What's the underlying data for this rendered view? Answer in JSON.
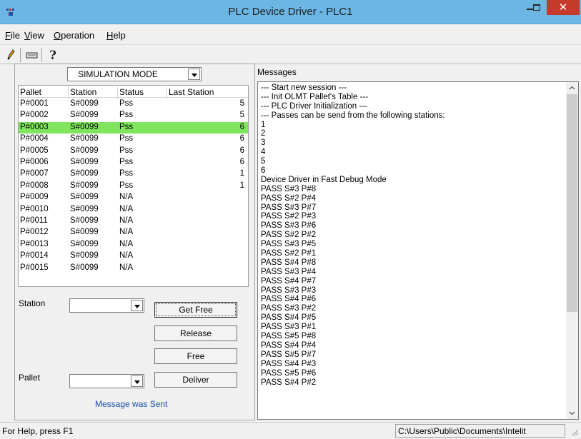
{
  "window": {
    "title": "PLC Device Driver - PLC1",
    "app_icon": "plc-icon",
    "controls": [
      "minimize-icon",
      "maximize-icon",
      "close-icon"
    ],
    "close_glyph": "✕"
  },
  "menu": {
    "items": [
      {
        "key": "F",
        "rest": "ile"
      },
      {
        "key": "V",
        "rest": "iew"
      },
      {
        "key": "O",
        "rest": "peration"
      },
      {
        "key": "H",
        "rest": "elp"
      }
    ]
  },
  "toolbar": {
    "icons": [
      "edit-pencil-icon",
      "keyboard-icon",
      "help-question-icon"
    ]
  },
  "left": {
    "mode_value": "SIMULATION MODE",
    "table": {
      "columns": [
        "Pallet",
        "Station",
        "Status",
        "Last Station"
      ],
      "selected_row": 2,
      "rows": [
        [
          "P#0001",
          "S#0099",
          "Pss",
          "5"
        ],
        [
          "P#0002",
          "S#0099",
          "Pss",
          "5"
        ],
        [
          "P#0003",
          "S#0099",
          "Pss",
          "6"
        ],
        [
          "P#0004",
          "S#0099",
          "Pss",
          "6"
        ],
        [
          "P#0005",
          "S#0099",
          "Pss",
          "6"
        ],
        [
          "P#0006",
          "S#0099",
          "Pss",
          "6"
        ],
        [
          "P#0007",
          "S#0099",
          "Pss",
          "1"
        ],
        [
          "P#0008",
          "S#0099",
          "Pss",
          "1"
        ],
        [
          "P#0009",
          "S#0099",
          "N/A",
          ""
        ],
        [
          "P#0010",
          "S#0099",
          "N/A",
          ""
        ],
        [
          "P#0011",
          "S#0099",
          "N/A",
          ""
        ],
        [
          "P#0012",
          "S#0099",
          "N/A",
          ""
        ],
        [
          "P#0013",
          "S#0099",
          "N/A",
          ""
        ],
        [
          "P#0014",
          "S#0099",
          "N/A",
          ""
        ],
        [
          "P#0015",
          "S#0099",
          "N/A",
          ""
        ]
      ]
    },
    "station_label": "Station",
    "station_value": "",
    "pallet_label": "Pallet",
    "pallet_value": "",
    "buttons": {
      "get_free": "Get Free",
      "release": "Release",
      "free": "Free",
      "deliver": "Deliver"
    },
    "status_message": "Message was Sent"
  },
  "right": {
    "label": "Messages",
    "messages": [
      "--- Start new session ---",
      "--- Init OLMT Pallet's Table ---",
      "--- PLC Driver Initialization ---",
      "--- Passes can be send from the following stations:",
      "1",
      "2",
      "3",
      "4",
      "5",
      "6",
      "Device Driver in Fast Debug Mode",
      "PASS S#3 P#8",
      "PASS S#2 P#4",
      "PASS S#3 P#7",
      "PASS S#2 P#3",
      "PASS S#3 P#6",
      "PASS S#2 P#2",
      "PASS S#3 P#5",
      "PASS S#2 P#1",
      "PASS S#4 P#8",
      "PASS S#3 P#4",
      "PASS S#4 P#7",
      "PASS S#3 P#3",
      "PASS S#4 P#6",
      "PASS S#3 P#2",
      "PASS S#4 P#5",
      "PASS S#3 P#1",
      "PASS S#5 P#8",
      "PASS S#4 P#4",
      "PASS S#5 P#7",
      "PASS S#4 P#3",
      "PASS S#5 P#6",
      "PASS S#4 P#2"
    ]
  },
  "statusbar": {
    "help": "For Help, press F1",
    "path": "C:\\Users\\Public\\Documents\\Intelit"
  },
  "colors": {
    "titlebar": "#6cb6e4",
    "close": "#c7392b",
    "selected_row": "#7ee55c",
    "status_message": "#1b4fa8"
  }
}
